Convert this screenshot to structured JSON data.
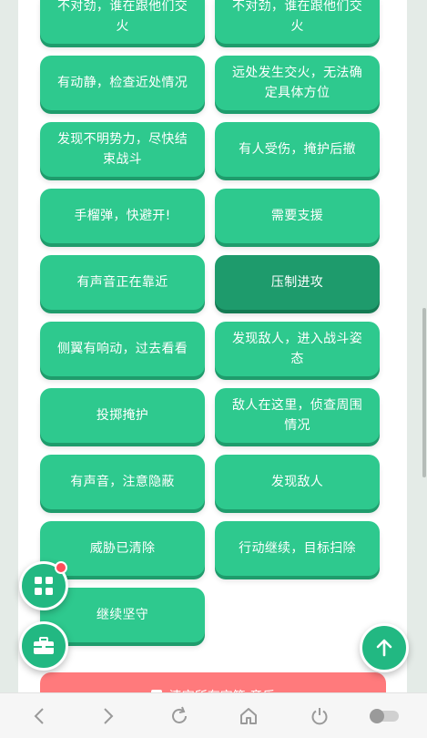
{
  "buttons": [
    {
      "label": "不对劲，谁在跟他们交火"
    },
    {
      "label": "不对劲，谁在跟他们交火"
    },
    {
      "label": "有动静，检查近处情况"
    },
    {
      "label": "远处发生交火，无法确定具体方位"
    },
    {
      "label": "发现不明势力，尽快结束战斗"
    },
    {
      "label": "有人受伤，掩护后撤"
    },
    {
      "label": "手榴弹，快避开!"
    },
    {
      "label": "需要支援"
    },
    {
      "label": "有声音正在靠近"
    },
    {
      "label": "压制进攻"
    },
    {
      "label": "侧翼有响动，过去看看"
    },
    {
      "label": "发现敌人，进入战斗姿态"
    },
    {
      "label": "投掷掩护"
    },
    {
      "label": "敌人在这里，侦查周围情况"
    },
    {
      "label": "有声音，注意隐蔽"
    },
    {
      "label": "发现敌人"
    },
    {
      "label": "威胁已清除"
    },
    {
      "label": "行动继续，目标扫除"
    },
    {
      "label": "继续坚守"
    }
  ],
  "clear_button": {
    "label": "清空所有字符 音乐"
  },
  "fab": {
    "grid_icon": "grid-icon",
    "toolbox_icon": "toolbox-icon",
    "up_icon": "arrow-up-icon"
  },
  "navbar": {
    "items": [
      "back-icon",
      "forward-icon",
      "refresh-icon",
      "home-icon",
      "power-icon",
      "toggle-icon"
    ]
  },
  "colors": {
    "button": "#2ec98e",
    "button_active": "#1e9b6c",
    "clear": "#ff7a7c",
    "badge": "#ff4d5a"
  }
}
